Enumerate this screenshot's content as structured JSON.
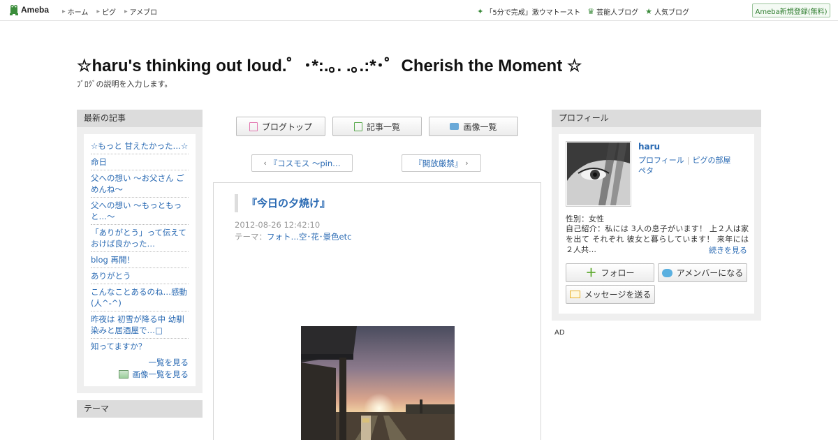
{
  "topbar": {
    "logo": "Ameba",
    "nav": [
      "ホーム",
      "ピグ",
      "アメブロ"
    ],
    "links": [
      {
        "icon": "sparkle-icon",
        "label": "「5分で完成」激ウマトースト"
      },
      {
        "icon": "crown-icon",
        "label": "芸能人ブログ"
      },
      {
        "icon": "star-icon",
        "label": "人気ブログ"
      }
    ],
    "signup": "Ameba新規登録(無料)"
  },
  "header": {
    "title": "☆haru's thinking out loud.゜･*:.｡. .｡.:*･゜Cherish the Moment ☆",
    "description": "ﾌﾞﾛｸﾞの説明を入力します。"
  },
  "left": {
    "recent_head": "最新の記事",
    "articles": [
      "☆もっと 甘えたかった…☆",
      "命日",
      "父への想い 〜お父さん ごめんね〜",
      "父への想い 〜もっともっと…〜",
      "「ありがとう」って伝えておけば良かった…",
      "blog 再開！",
      "ありがとう",
      "こんなことあるのね…感動(人^-^)",
      "昨夜は 初雪が降る中 幼馴染みと居酒屋で…□",
      "知ってますか？"
    ],
    "list_link": "一覧を見る",
    "image_list_link": "画像一覧を見る",
    "theme_head": "テーマ"
  },
  "center": {
    "tabs": [
      {
        "icon": "document-icon",
        "label": "ブログトップ"
      },
      {
        "icon": "pages-icon",
        "label": "記事一覧"
      },
      {
        "icon": "camera-icon",
        "label": "画像一覧"
      }
    ],
    "prev": "『コスモス ～pin…",
    "next": "『開放厳禁』",
    "entry": {
      "title": "『今日の夕焼け』",
      "date": "2012-08-26 12:42:10",
      "theme_label": "テーマ：",
      "theme": "フォト…空･花･景色etc"
    }
  },
  "right": {
    "profile_head": "プロフィール",
    "name": "haru",
    "links": [
      "プロフィール",
      "ピグの部屋",
      "ペタ"
    ],
    "sex": "性別：女性",
    "intro": "自己紹介：私には 3人の息子がいます！ 上２人は家を出て それぞれ 彼女と暮らしています！ 来年には ２人共…",
    "more": "続きを見る",
    "follow": "フォロー",
    "member": "アメンバーになる",
    "message": "メッセージを送る",
    "ad": "AD"
  },
  "colors": {
    "link": "#2a6ab3",
    "accent_green": "#3a8a3a"
  }
}
